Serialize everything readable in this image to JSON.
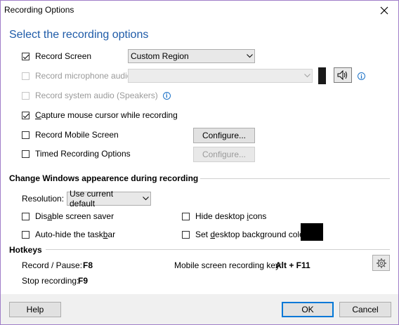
{
  "window": {
    "title": "Recording Options"
  },
  "heading": "Select the recording options",
  "options": {
    "record_screen": {
      "label": "Record Screen",
      "checked": true
    },
    "region_select": {
      "value": "Custom Region"
    },
    "record_mic": {
      "label": "Record microphone audio",
      "checked": false,
      "disabled": true
    },
    "record_system": {
      "label": "Record system audio (Speakers)",
      "checked": false,
      "disabled": true
    },
    "capture_cursor": {
      "label_pre": "",
      "label_u": "C",
      "label_post": "apture mouse cursor while recording",
      "checked": true
    },
    "record_mobile": {
      "label": "Record Mobile Screen",
      "checked": false
    },
    "timed": {
      "label": "Timed Recording Options",
      "checked": false
    },
    "configure_label": "Configure..."
  },
  "appearance": {
    "section": "Change Windows appearence during recording",
    "resolution_label": "Resolution:",
    "resolution_value": "Use current default",
    "disable_saver": {
      "pre": "Dis",
      "u": "a",
      "post": "ble screen saver"
    },
    "auto_hide": {
      "pre": "Auto-hide the task",
      "u": "b",
      "post": "ar"
    },
    "hide_icons": {
      "pre": "Hide desktop ",
      "u": "i",
      "post": "cons"
    },
    "set_bg": {
      "pre": "Set ",
      "u": "d",
      "post": "esktop background color:"
    },
    "bg_color": "#000000"
  },
  "hotkeys": {
    "section": "Hotkeys",
    "record_pause_label": "Record / Pause:",
    "record_pause_key": "F8",
    "stop_label": "Stop recording:",
    "stop_key": "F9",
    "mobile_label": "Mobile screen recording key:",
    "mobile_key": "Alt + F11"
  },
  "footer": {
    "help": "Help",
    "ok": "OK",
    "cancel": "Cancel"
  }
}
